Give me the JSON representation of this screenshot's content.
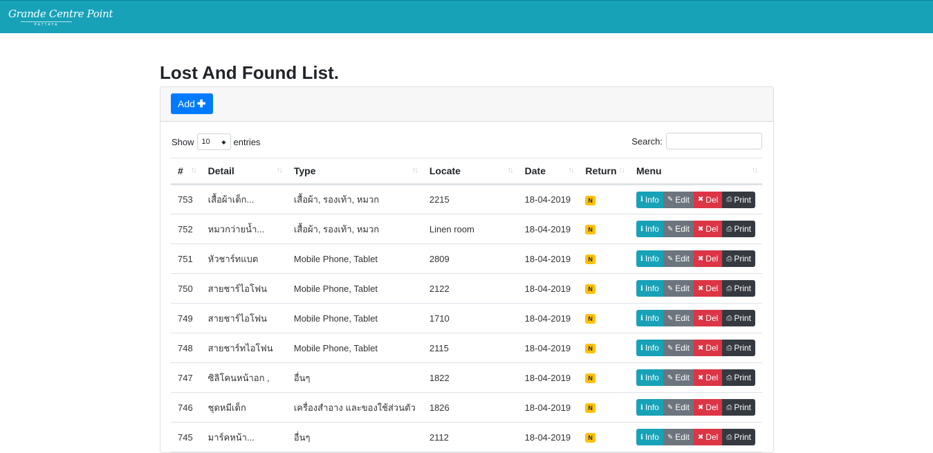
{
  "nav": {
    "logo_main": "Grande Centre Point",
    "logo_sub": "PATTAYA"
  },
  "page": {
    "title": "Lost And Found List."
  },
  "toolbar": {
    "add_label": "Add"
  },
  "datatable": {
    "show_label": "Show",
    "entries_value": "10",
    "entries_label": "entries",
    "search_label": "Search:",
    "search_value": ""
  },
  "columns": [
    "#",
    "Detail",
    "Type",
    "Locate",
    "Date",
    "Return",
    "Menu"
  ],
  "actions": {
    "info": "Info",
    "edit": "Edit",
    "del": "Del",
    "print": "Print"
  },
  "rows": [
    {
      "id": "753",
      "detail": "เสื้อผ้าเด็ก...",
      "type": "เสื้อผ้า, รองเท้า, หมวก",
      "locate": "2215",
      "date": "18-04-2019",
      "return": "N"
    },
    {
      "id": "752",
      "detail": "หมวกว่ายน้ำ...",
      "type": "เสื้อผ้า, รองเท้า, หมวก",
      "locate": "Linen room",
      "date": "18-04-2019",
      "return": "N"
    },
    {
      "id": "751",
      "detail": "หัวชาร์ทแบต",
      "type": "Mobile Phone, Tablet",
      "locate": "2809",
      "date": "18-04-2019",
      "return": "N"
    },
    {
      "id": "750",
      "detail": "สายชาร์ไอโฟน",
      "type": "Mobile Phone, Tablet",
      "locate": "2122",
      "date": "18-04-2019",
      "return": "N"
    },
    {
      "id": "749",
      "detail": "สายชาร์ไอโฟน",
      "type": "Mobile Phone, Tablet",
      "locate": "1710",
      "date": "18-04-2019",
      "return": "N"
    },
    {
      "id": "748",
      "detail": "สายชาร์ทไอโฟน",
      "type": "Mobile Phone, Tablet",
      "locate": "2115",
      "date": "18-04-2019",
      "return": "N"
    },
    {
      "id": "747",
      "detail": "ซิลิโคนหน้าอก ,",
      "type": "อื่นๆ",
      "locate": "1822",
      "date": "18-04-2019",
      "return": "N"
    },
    {
      "id": "746",
      "detail": "ชุดหมีเด็ก",
      "type": "เครื่องสำอาง และของใช้ส่วนตัว",
      "locate": "1826",
      "date": "18-04-2019",
      "return": "N"
    },
    {
      "id": "745",
      "detail": "มาร์คหน้า...",
      "type": "อื่นๆ",
      "locate": "2112",
      "date": "18-04-2019",
      "return": "N"
    }
  ],
  "colors": {
    "navbar": "#17a2b8",
    "primary": "#007bff",
    "badge": "#ffc107",
    "danger": "#dc3545",
    "secondary": "#6c757d",
    "dark": "#343a40"
  }
}
